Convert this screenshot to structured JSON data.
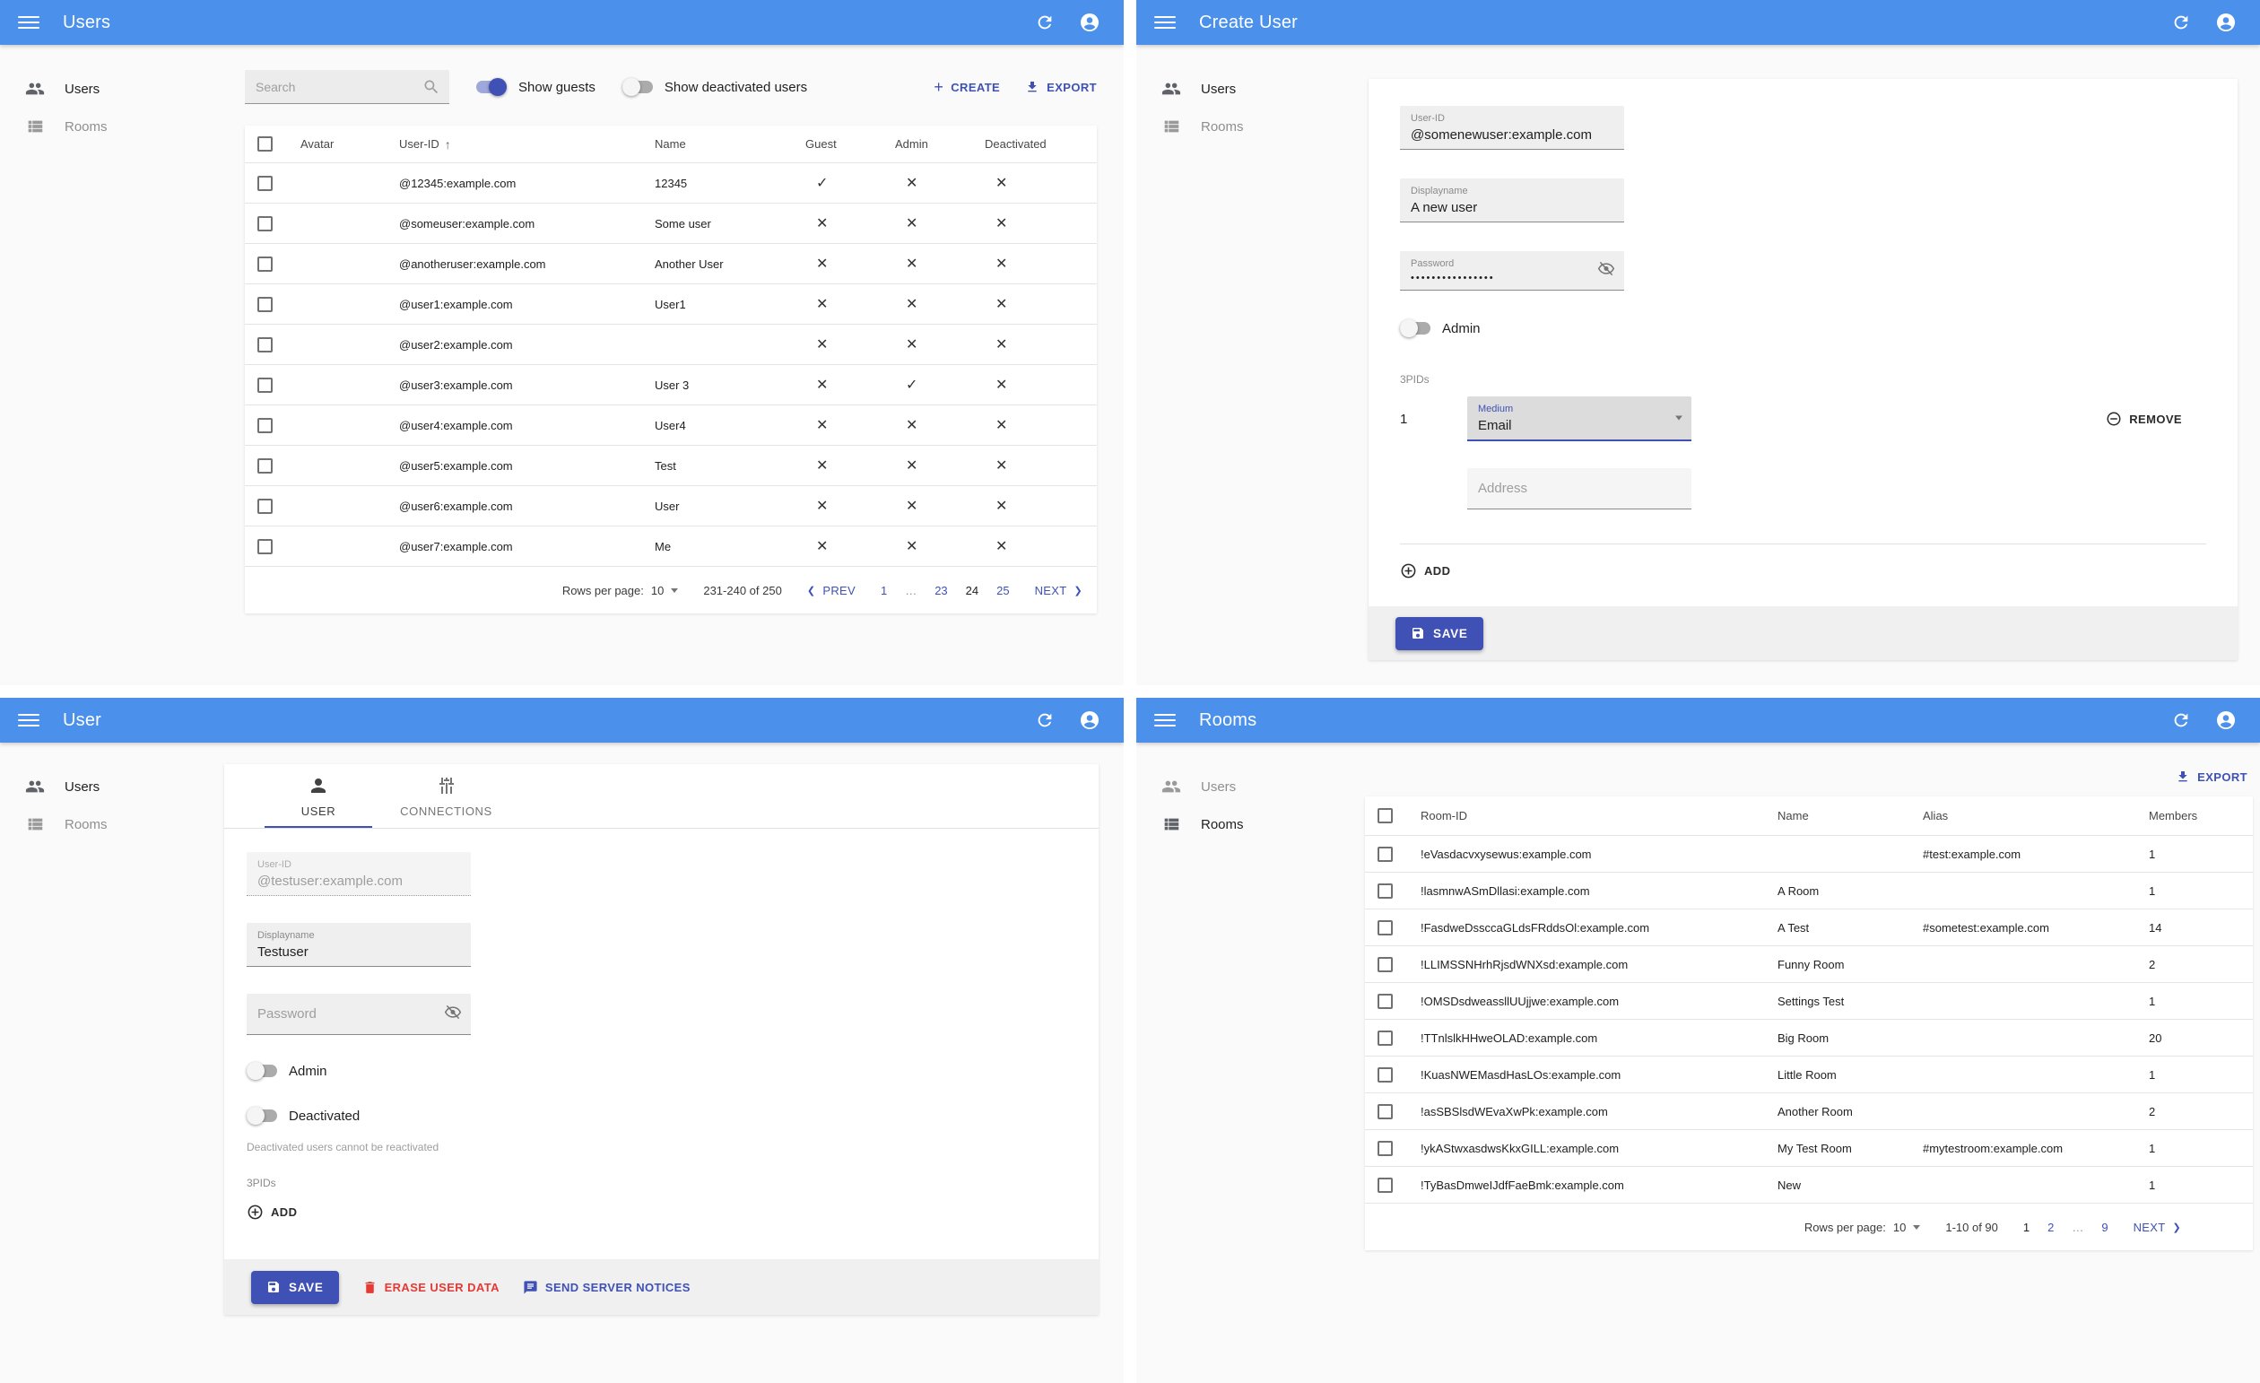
{
  "colors": {
    "app_bar": "#4b90ea",
    "primary": "#3f51b5",
    "danger": "#e53935",
    "page_bg": "#fafafa"
  },
  "users_page": {
    "app_bar": {
      "title": "Users"
    },
    "sidebar": [
      {
        "label": "Users",
        "active": true,
        "is_users": true,
        "is_rooms": false
      },
      {
        "label": "Rooms",
        "active": false,
        "is_users": false,
        "is_rooms": true
      }
    ],
    "toolbar": {
      "search_placeholder": "Search",
      "toggles": [
        {
          "label": "Show guests",
          "on": true
        },
        {
          "label": "Show deactivated users",
          "on": false
        }
      ],
      "create_label": "CREATE",
      "export_label": "EXPORT"
    },
    "table": {
      "headers": {
        "avatar": "Avatar",
        "user_id": "User-ID",
        "sort_arrow": "↑",
        "name": "Name",
        "guest": "Guest",
        "admin": "Admin",
        "deactivated": "Deactivated"
      },
      "rows": [
        {
          "user_id": "@12345:example.com",
          "name": "12345",
          "guest": "✓",
          "admin": "✕",
          "deactivated": "✕"
        },
        {
          "user_id": "@someuser:example.com",
          "name": "Some user",
          "guest": "✕",
          "admin": "✕",
          "deactivated": "✕"
        },
        {
          "user_id": "@anotheruser:example.com",
          "name": "Another User",
          "guest": "✕",
          "admin": "✕",
          "deactivated": "✕"
        },
        {
          "user_id": "@user1:example.com",
          "name": "User1",
          "guest": "✕",
          "admin": "✕",
          "deactivated": "✕"
        },
        {
          "user_id": "@user2:example.com",
          "name": "",
          "guest": "✕",
          "admin": "✕",
          "deactivated": "✕"
        },
        {
          "user_id": "@user3:example.com",
          "name": "User 3",
          "guest": "✕",
          "admin": "✓",
          "deactivated": "✕"
        },
        {
          "user_id": "@user4:example.com",
          "name": "User4",
          "guest": "✕",
          "admin": "✕",
          "deactivated": "✕"
        },
        {
          "user_id": "@user5:example.com",
          "name": "Test",
          "guest": "✕",
          "admin": "✕",
          "deactivated": "✕"
        },
        {
          "user_id": "@user6:example.com",
          "name": "User",
          "guest": "✕",
          "admin": "✕",
          "deactivated": "✕"
        },
        {
          "user_id": "@user7:example.com",
          "name": "Me",
          "guest": "✕",
          "admin": "✕",
          "deactivated": "✕"
        }
      ]
    },
    "pagination": {
      "rows_per_page_label": "Rows per page:",
      "rows_per_page": "10",
      "range": "231-240 of 250",
      "prev_chevron": "❮",
      "prev_label": "PREV",
      "next_label": "NEXT",
      "next_chevron": "❯",
      "pages": [
        {
          "label": "1"
        },
        {
          "label": "…",
          "ellipsis": true
        },
        {
          "label": "23"
        },
        {
          "label": "24",
          "current": true
        },
        {
          "label": "25"
        }
      ]
    }
  },
  "create_user_page": {
    "app_bar": {
      "title": "Create User"
    },
    "sidebar": [
      {
        "label": "Users",
        "active": true,
        "is_users": true,
        "is_rooms": false
      },
      {
        "label": "Rooms",
        "active": false,
        "is_users": false,
        "is_rooms": true
      }
    ],
    "form": {
      "user_id": {
        "label": "User-ID",
        "value": "@somenewuser:example.com"
      },
      "displayname": {
        "label": "Displayname",
        "value": "A new user"
      },
      "password": {
        "label": "Password",
        "value": "••••••••••••••••"
      },
      "admin_toggle": {
        "label": "Admin",
        "on": false
      },
      "threepids": {
        "section_label": "3PIDs",
        "rows": [
          {
            "index": "1",
            "medium_label": "Medium",
            "medium_value": "Email",
            "remove_label": "REMOVE"
          }
        ],
        "address_placeholder": "Address",
        "add_label": "ADD"
      },
      "save_label": "SAVE"
    }
  },
  "user_page": {
    "app_bar": {
      "title": "User"
    },
    "sidebar": [
      {
        "label": "Users",
        "active": true,
        "is_users": true,
        "is_rooms": false
      },
      {
        "label": "Rooms",
        "active": false,
        "is_users": false,
        "is_rooms": true
      }
    ],
    "tabs": [
      {
        "label": "USER",
        "active": true,
        "is_user": true,
        "is_connections": false
      },
      {
        "label": "CONNECTIONS",
        "active": false,
        "is_user": false,
        "is_connections": true,
        "wide": true
      }
    ],
    "form": {
      "user_id": {
        "label": "User-ID",
        "value": "@testuser:example.com"
      },
      "displayname": {
        "label": "Displayname",
        "value": "Testuser"
      },
      "password_placeholder": "Password",
      "admin_toggle": {
        "label": "Admin",
        "on": false
      },
      "deactivated_toggle": {
        "label": "Deactivated",
        "on": false
      },
      "deactivated_helper": "Deactivated users cannot be reactivated",
      "threepids_label": "3PIDs",
      "add_label": "ADD",
      "save_label": "SAVE",
      "erase_label": "ERASE USER DATA",
      "notices_label": "SEND SERVER NOTICES"
    }
  },
  "rooms_page": {
    "app_bar": {
      "title": "Rooms"
    },
    "sidebar": [
      {
        "label": "Users",
        "active": false,
        "is_users": true,
        "is_rooms": false
      },
      {
        "label": "Rooms",
        "active": true,
        "is_users": false,
        "is_rooms": true
      }
    ],
    "toolbar": {
      "export_label": "EXPORT"
    },
    "table": {
      "headers": {
        "room_id": "Room-ID",
        "name": "Name",
        "alias": "Alias",
        "members": "Members"
      },
      "rows": [
        {
          "room_id": "!eVasdacvxysewus:example.com",
          "name": "",
          "alias": "#test:example.com",
          "members": "1"
        },
        {
          "room_id": "!lasmnwASmDllasi:example.com",
          "name": "A Room",
          "alias": "",
          "members": "1"
        },
        {
          "room_id": "!FasdweDssccaGLdsFRddsOl:example.com",
          "name": "A Test",
          "alias": "#sometest:example.com",
          "members": "14"
        },
        {
          "room_id": "!LLIMSSNHrhRjsdWNXsd:example.com",
          "name": "Funny Room",
          "alias": "",
          "members": "2"
        },
        {
          "room_id": "!OMSDsdweassllUUjjwe:example.com",
          "name": "Settings Test",
          "alias": "",
          "members": "1"
        },
        {
          "room_id": "!TTnlslkHHweOLAD:example.com",
          "name": "Big Room",
          "alias": "",
          "members": "20"
        },
        {
          "room_id": "!KuasNWEMasdHasLOs:example.com",
          "name": "Little Room",
          "alias": "",
          "members": "1"
        },
        {
          "room_id": "!asSBSlsdWEvaXwPk:example.com",
          "name": "Another Room",
          "alias": "",
          "members": "2"
        },
        {
          "room_id": "!ykAStwxasdwsKkxGILL:example.com",
          "name": "My Test Room",
          "alias": "#mytestroom:example.com",
          "members": "1"
        },
        {
          "room_id": "!TyBasDmweIJdfFaeBmk:example.com",
          "name": "New",
          "alias": "",
          "members": "1"
        }
      ]
    },
    "pagination": {
      "rows_per_page_label": "Rows per page:",
      "rows_per_page": "10",
      "range": "1-10 of 90",
      "next_label": "NEXT",
      "next_chevron": "❯",
      "pages": [
        {
          "label": "1",
          "current": true
        },
        {
          "label": "2"
        },
        {
          "label": "…",
          "ellipsis": true
        },
        {
          "label": "9"
        }
      ]
    }
  }
}
